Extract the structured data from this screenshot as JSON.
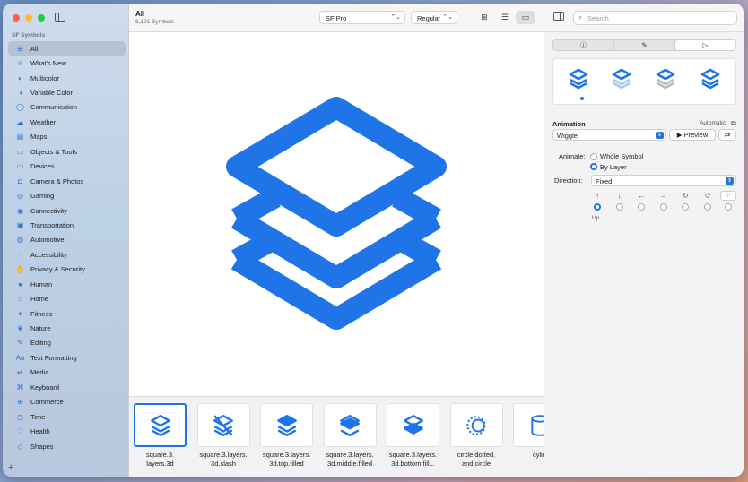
{
  "sidebar": {
    "section_title": "SF Symbols",
    "items": [
      {
        "label": "All",
        "icon": "grid-icon",
        "glyph": "⊞"
      },
      {
        "label": "What's New",
        "icon": "sparkle-icon",
        "glyph": "✧"
      },
      {
        "label": "Multicolor",
        "icon": "palette-icon",
        "glyph": "◐"
      },
      {
        "label": "Variable Color",
        "icon": "variable-color-icon",
        "glyph": "◑"
      },
      {
        "label": "Communication",
        "icon": "message-icon",
        "glyph": "◯"
      },
      {
        "label": "Weather",
        "icon": "cloud-icon",
        "glyph": "☁"
      },
      {
        "label": "Maps",
        "icon": "map-icon",
        "glyph": "▤"
      },
      {
        "label": "Objects & Tools",
        "icon": "folder-icon",
        "glyph": "▭"
      },
      {
        "label": "Devices",
        "icon": "display-icon",
        "glyph": "▭"
      },
      {
        "label": "Camera & Photos",
        "icon": "camera-icon",
        "glyph": "◘"
      },
      {
        "label": "Gaming",
        "icon": "gamecontroller-icon",
        "glyph": "◎"
      },
      {
        "label": "Connectivity",
        "icon": "antenna-icon",
        "glyph": "◉"
      },
      {
        "label": "Transportation",
        "icon": "car-icon",
        "glyph": "▣"
      },
      {
        "label": "Automotive",
        "icon": "steering-wheel-icon",
        "glyph": "◍"
      },
      {
        "label": "Accessibility",
        "icon": "accessibility-icon",
        "glyph": "◌"
      },
      {
        "label": "Privacy & Security",
        "icon": "hand-icon",
        "glyph": "✋"
      },
      {
        "label": "Human",
        "icon": "person-icon",
        "glyph": "●"
      },
      {
        "label": "Home",
        "icon": "house-icon",
        "glyph": "⌂"
      },
      {
        "label": "Fitness",
        "icon": "figure-run-icon",
        "glyph": "✦"
      },
      {
        "label": "Nature",
        "icon": "leaf-icon",
        "glyph": "❦"
      },
      {
        "label": "Editing",
        "icon": "pencil-icon",
        "glyph": "✎"
      },
      {
        "label": "Text Formatting",
        "icon": "textformat-icon",
        "glyph": "Aa"
      },
      {
        "label": "Media",
        "icon": "playpause-icon",
        "glyph": "⏯"
      },
      {
        "label": "Keyboard",
        "icon": "command-icon",
        "glyph": "⌘"
      },
      {
        "label": "Commerce",
        "icon": "cart-icon",
        "glyph": "⊕"
      },
      {
        "label": "Time",
        "icon": "clock-icon",
        "glyph": "◷"
      },
      {
        "label": "Health",
        "icon": "heart-icon",
        "glyph": "♡"
      },
      {
        "label": "Shapes",
        "icon": "shapes-icon",
        "glyph": "◇"
      }
    ],
    "add_label": "+"
  },
  "toolbar": {
    "title": "All",
    "subtitle": "6,191 Symbols",
    "font": "SF Pro",
    "weight": "Regular",
    "search_placeholder": "Search"
  },
  "strip": {
    "tiles": [
      {
        "label": "square.3.\nlayers.3d",
        "selected": true
      },
      {
        "label": "square.3.layers.\n3d.slash",
        "selected": false
      },
      {
        "label": "square.3.layers.\n3d.top.filled",
        "selected": false
      },
      {
        "label": "square.3.layers.\n3d.middle.filled",
        "selected": false
      },
      {
        "label": "square.3.layers.\n3d.bottom.fill...",
        "selected": false
      },
      {
        "label": "circle.dotted.\nand.circle",
        "selected": false
      },
      {
        "label": "cylin",
        "selected": false
      }
    ]
  },
  "inspector": {
    "tabs": [
      "ⓘ",
      "✎",
      "▷"
    ],
    "animation_label": "Animation",
    "automatic_label": "Automatic",
    "effect": "Wiggle",
    "preview_label": "▶ Preview",
    "loop_glyph": "⇄",
    "animate_label": "Animate:",
    "animate_options": [
      "Whole Symbol",
      "By Layer"
    ],
    "direction_label": "Direction:",
    "direction_value": "Fixed",
    "direction_arrows": [
      "↑",
      "↓",
      "←",
      "→",
      "↻",
      "↺"
    ],
    "degree_placeholder": "0°",
    "selected_direction": "Up"
  },
  "colors": {
    "accent": "#1f74e8",
    "symbol": "#1f74e8"
  }
}
